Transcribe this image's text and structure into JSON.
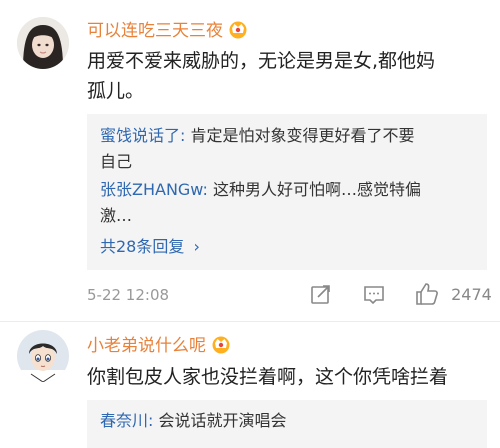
{
  "comments": [
    {
      "username": "可以连吃三天三夜",
      "badge_icon": "vip-crown-badge-icon",
      "text_line1": "用爱不爱来威胁的，无论是男是女,都他妈",
      "text_line2": "孤儿。",
      "replies": [
        {
          "user": "蜜饯说话了:",
          "line1": " 肯定是怕对象变得更好看了不要",
          "line2": "自己"
        },
        {
          "user": "张张ZHANGw:",
          "line1": " 这种男人好可怕啊…感觉特偏",
          "line2": "激…"
        }
      ],
      "more_replies": "共28条回复",
      "timestamp": "5-22 12:08",
      "like_count": "2474",
      "icons": [
        "share-icon",
        "comment-icon",
        "like-icon"
      ]
    },
    {
      "username": "小老弟说什么呢",
      "badge_icon": "vip-crown-badge-icon",
      "text_line1": "你割包皮人家也没拦着啊，这个你凭啥拦着",
      "replies": [
        {
          "user": "春奈川:",
          "line1": " 会说话就开演唱会"
        }
      ]
    }
  ],
  "colors": {
    "username": "#e8823a",
    "reply_user": "#2f68b0",
    "reply_bg": "#f4f4f4",
    "meta": "#999999"
  }
}
